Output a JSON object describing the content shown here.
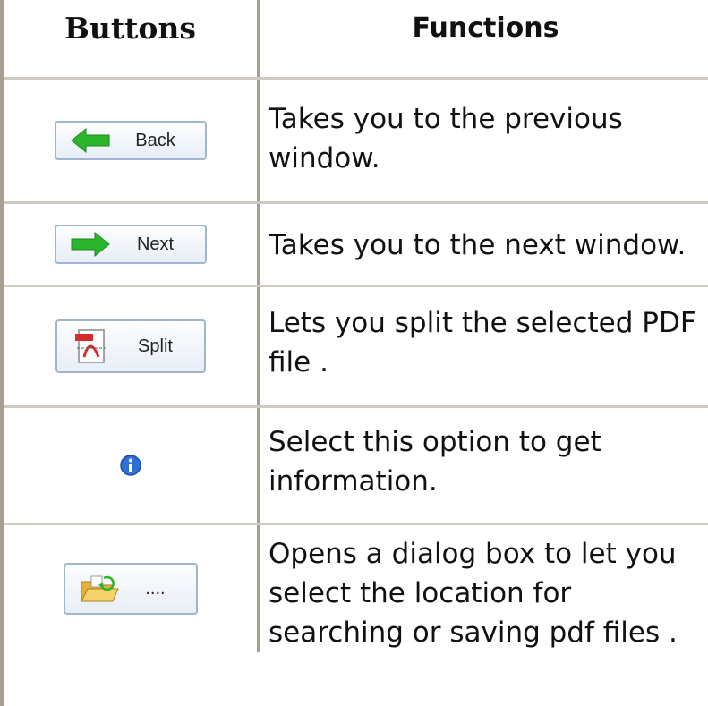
{
  "header": {
    "buttons": "Buttons",
    "functions": "Functions"
  },
  "rows": [
    {
      "label": "Back",
      "icon": "left-arrow-icon",
      "description": "Takes you to the previous window."
    },
    {
      "label": "Next",
      "icon": "right-arrow-icon",
      "description": "Takes you to the next window."
    },
    {
      "label": "Split",
      "icon": "pdf-split-icon",
      "description": "Lets you split the selected PDF file ."
    },
    {
      "label": "",
      "icon": "info-icon",
      "description": "Select this option to get information."
    },
    {
      "label": "....",
      "icon": "folder-open-icon",
      "description": "Opens a dialog box to let you select the location for searching or saving pdf files ."
    }
  ],
  "colors": {
    "arrow_green": "#2bb52b",
    "info_blue": "#2f6fd6",
    "border": "#a69f92"
  }
}
